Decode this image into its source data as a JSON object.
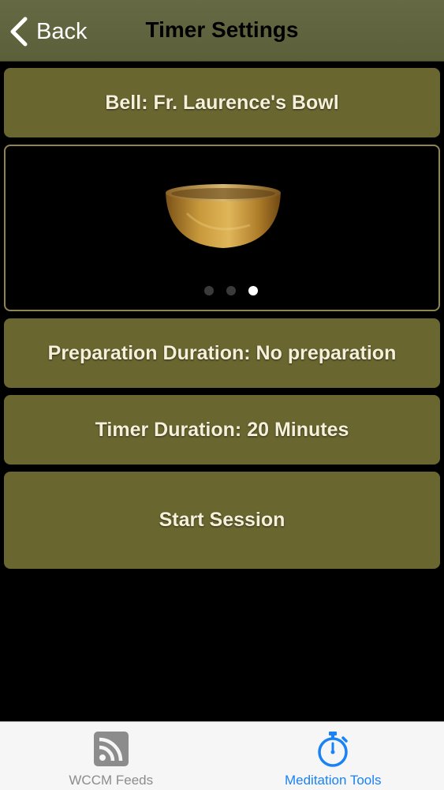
{
  "nav": {
    "back_label": "Back",
    "title": "Timer Settings"
  },
  "bell": {
    "label": "Bell: Fr. Laurence's Bowl"
  },
  "carousel": {
    "image_icon": "singing-bowl",
    "page_count": 3,
    "current_page": 3
  },
  "preparation": {
    "label": "Preparation Duration: No preparation"
  },
  "timer": {
    "label": "Timer Duration: 20 Minutes"
  },
  "start": {
    "label": "Start Session"
  },
  "tabbar": {
    "tabs": [
      {
        "label": "WCCM Feeds",
        "icon": "rss-feed-icon",
        "active": false
      },
      {
        "label": "Meditation Tools",
        "icon": "stopwatch-icon",
        "active": true
      }
    ]
  },
  "colors": {
    "accent": "#1a82f7",
    "button": "#6a6630",
    "navbar": "#626640"
  }
}
